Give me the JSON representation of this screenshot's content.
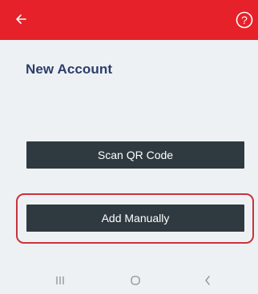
{
  "header": {
    "background_color": "#e62129",
    "back_icon": "arrow-left-icon",
    "help_icon": "question-circle-icon"
  },
  "page": {
    "title": "New Account"
  },
  "actions": {
    "scan_label": "Scan QR Code",
    "manual_label": "Add Manually",
    "button_color": "#2f3a40",
    "highlight_color": "#c8333b"
  },
  "nav": {
    "recents_icon": "recent-apps-icon",
    "home_icon": "home-icon",
    "back_icon": "nav-back-icon"
  }
}
